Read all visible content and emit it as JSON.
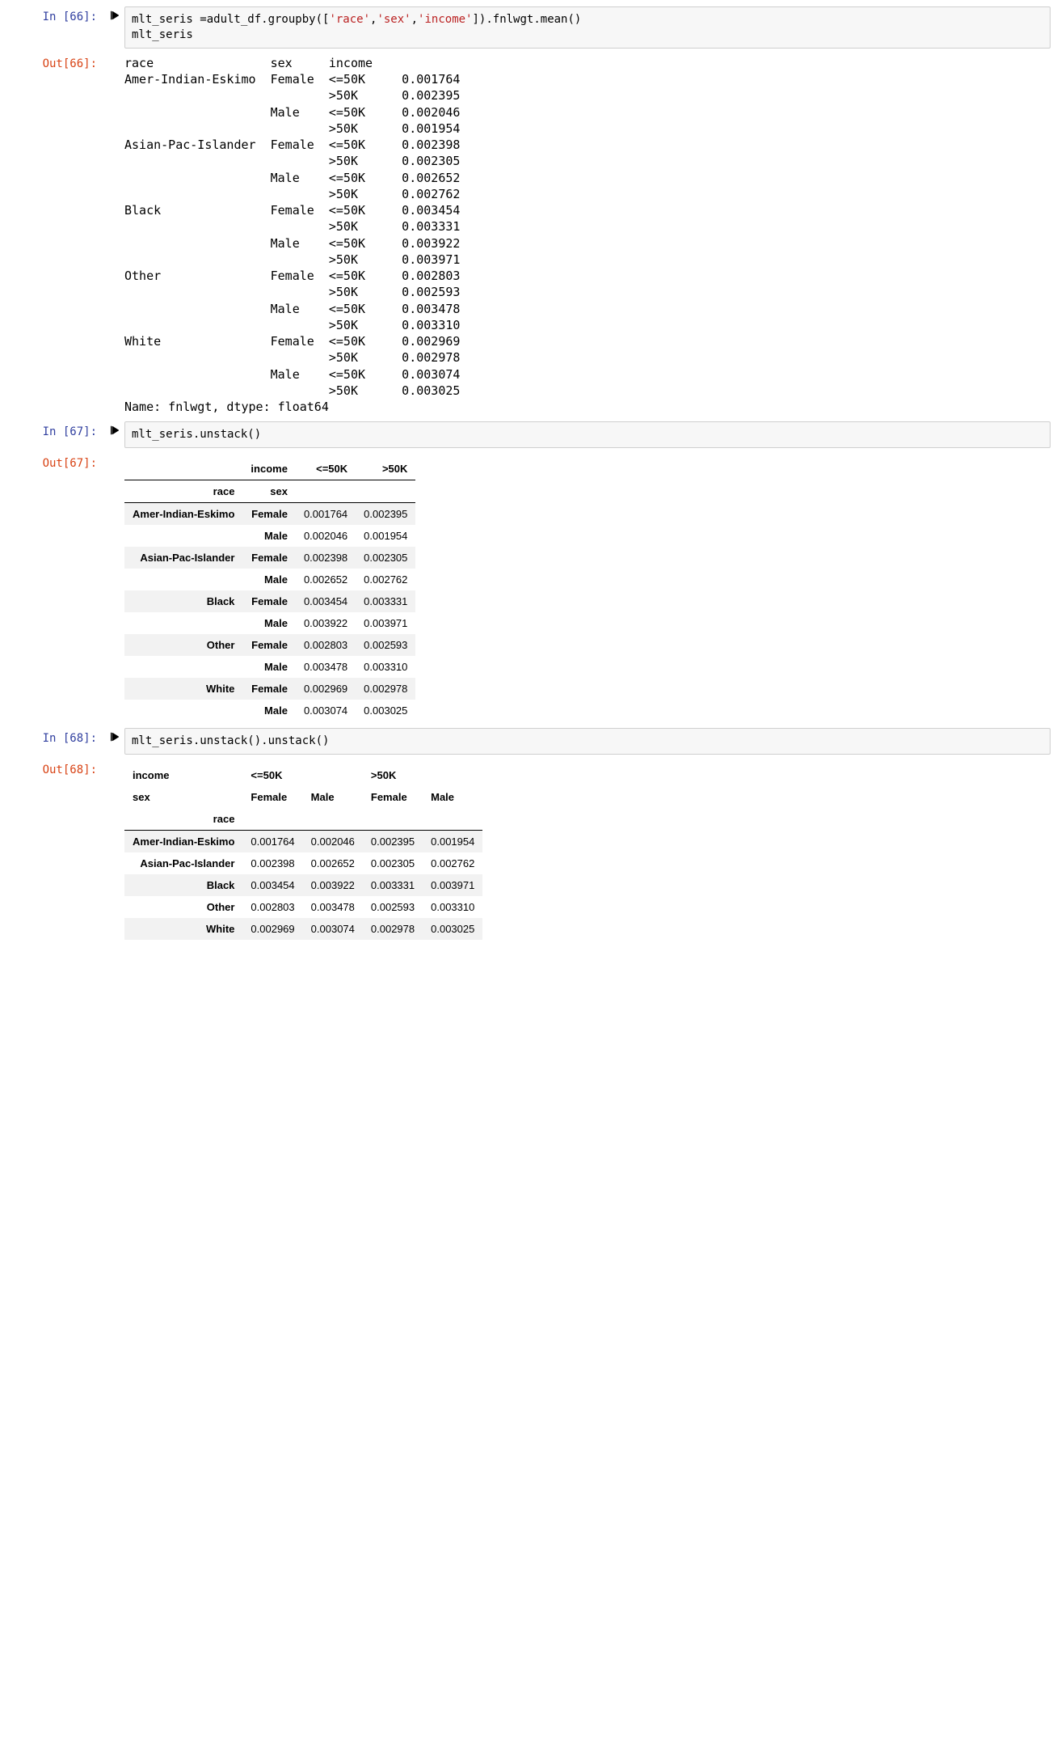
{
  "cells": {
    "c66": {
      "in_prompt": "In [66]:",
      "out_prompt": "Out[66]:",
      "code_plain": "mlt_seris =adult_df.groupby(['race','sex','income']).fnlwgt.mean()\nmlt_seris",
      "code_parts": {
        "l1_a": "mlt_seris =adult_df.groupby([",
        "s1": "'race'",
        "c1": ",",
        "s2": "'sex'",
        "c2": ",",
        "s3": "'income'",
        "l1_b": "]).fnlwgt.mean()",
        "l2": "mlt_seris"
      },
      "output_lines": [
        "race                sex     income",
        "Amer-Indian-Eskimo  Female  <=50K     0.001764",
        "                            >50K      0.002395",
        "                    Male    <=50K     0.002046",
        "                            >50K      0.001954",
        "Asian-Pac-Islander  Female  <=50K     0.002398",
        "                            >50K      0.002305",
        "                    Male    <=50K     0.002652",
        "                            >50K      0.002762",
        "Black               Female  <=50K     0.003454",
        "                            >50K      0.003331",
        "                    Male    <=50K     0.003922",
        "                            >50K      0.003971",
        "Other               Female  <=50K     0.002803",
        "                            >50K      0.002593",
        "                    Male    <=50K     0.003478",
        "                            >50K      0.003310",
        "White               Female  <=50K     0.002969",
        "                            >50K      0.002978",
        "                    Male    <=50K     0.003074",
        "                            >50K      0.003025",
        "Name: fnlwgt, dtype: float64"
      ]
    },
    "c67": {
      "in_prompt": "In [67]:",
      "out_prompt": "Out[67]:",
      "code": "mlt_seris.unstack()",
      "head": {
        "top_label": "income",
        "cols": [
          "<=50K",
          ">50K"
        ],
        "row_idx_labels": [
          "race",
          "sex"
        ]
      },
      "rows": [
        {
          "race": "Amer-Indian-Eskimo",
          "sex": "Female",
          "v": [
            "0.001764",
            "0.002395"
          ]
        },
        {
          "race": "",
          "sex": "Male",
          "v": [
            "0.002046",
            "0.001954"
          ]
        },
        {
          "race": "Asian-Pac-Islander",
          "sex": "Female",
          "v": [
            "0.002398",
            "0.002305"
          ]
        },
        {
          "race": "",
          "sex": "Male",
          "v": [
            "0.002652",
            "0.002762"
          ]
        },
        {
          "race": "Black",
          "sex": "Female",
          "v": [
            "0.003454",
            "0.003331"
          ]
        },
        {
          "race": "",
          "sex": "Male",
          "v": [
            "0.003922",
            "0.003971"
          ]
        },
        {
          "race": "Other",
          "sex": "Female",
          "v": [
            "0.002803",
            "0.002593"
          ]
        },
        {
          "race": "",
          "sex": "Male",
          "v": [
            "0.003478",
            "0.003310"
          ]
        },
        {
          "race": "White",
          "sex": "Female",
          "v": [
            "0.002969",
            "0.002978"
          ]
        },
        {
          "race": "",
          "sex": "Male",
          "v": [
            "0.003074",
            "0.003025"
          ]
        }
      ]
    },
    "c68": {
      "in_prompt": "In [68]:",
      "out_prompt": "Out[68]:",
      "code": "mlt_seris.unstack().unstack()",
      "head": {
        "lv1_label": "income",
        "lv1_cols": [
          "<=50K",
          ">50K"
        ],
        "lv2_label": "sex",
        "lv2_cols": [
          "Female",
          "Male",
          "Female",
          "Male"
        ],
        "row_idx_label": "race"
      },
      "rows": [
        {
          "race": "Amer-Indian-Eskimo",
          "v": [
            "0.001764",
            "0.002046",
            "0.002395",
            "0.001954"
          ]
        },
        {
          "race": "Asian-Pac-Islander",
          "v": [
            "0.002398",
            "0.002652",
            "0.002305",
            "0.002762"
          ]
        },
        {
          "race": "Black",
          "v": [
            "0.003454",
            "0.003922",
            "0.003331",
            "0.003971"
          ]
        },
        {
          "race": "Other",
          "v": [
            "0.002803",
            "0.003478",
            "0.002593",
            "0.003310"
          ]
        },
        {
          "race": "White",
          "v": [
            "0.002969",
            "0.003074",
            "0.002978",
            "0.003025"
          ]
        }
      ]
    }
  }
}
